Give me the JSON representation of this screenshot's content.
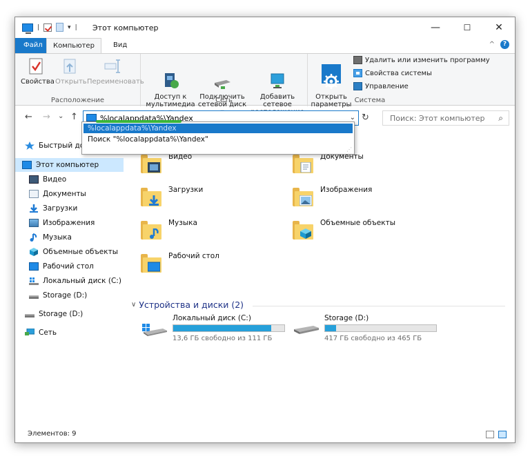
{
  "window": {
    "title": "Этот компьютер",
    "qat_separator": "|",
    "qat_dropdown": "▾",
    "controls": {
      "minimize": "—",
      "maximize": "☐",
      "close": "✕"
    },
    "help_chevron": "^",
    "help_label": "?"
  },
  "ribbon": {
    "tabs": [
      "Файл",
      "Компьютер",
      "Вид"
    ],
    "groups": {
      "location": {
        "label": "Расположение",
        "buttons": [
          {
            "label": "Свойства",
            "icon": "properties-icon",
            "enabled": true
          },
          {
            "label": "Открыть",
            "icon": "open-icon",
            "enabled": false
          },
          {
            "label": "Переименовать",
            "icon": "rename-icon",
            "enabled": false
          }
        ]
      },
      "network": {
        "label": "Сеть",
        "buttons": [
          {
            "label": "Доступ к\nмультимедиа ▾",
            "icon": "media-access-icon"
          },
          {
            "label": "Подключить\nсетевой диск ▾",
            "icon": "map-network-drive-icon"
          },
          {
            "label": "Добавить сетевое\nрасположение",
            "icon": "add-network-location-icon"
          }
        ]
      },
      "system": {
        "label": "Система",
        "open_settings": "Открыть\nпараметры",
        "items": [
          "Удалить или изменить программу",
          "Свойства системы",
          "Управление"
        ]
      }
    }
  },
  "address": {
    "nav": {
      "back": "←",
      "forward": "→",
      "recent": "⌄",
      "up": "↑"
    },
    "value": "%localappdata%\\Yandex",
    "dropdown_caret": "⌄",
    "refresh": "↻",
    "search_placeholder": "Поиск: Этот компьютер",
    "search_icon": "⌕",
    "suggestions": {
      "highlighted": "%localappdata%\\Yandex",
      "search": "Поиск \"%localappdata%\\Yandex\""
    }
  },
  "sidebar": {
    "items": [
      {
        "label": "Быстрый доступ",
        "icon": "star-icon"
      },
      {
        "label": "Этот компьютер",
        "icon": "computer-icon",
        "selected": true
      },
      {
        "label": "Видео",
        "icon": "video-icon"
      },
      {
        "label": "Документы",
        "icon": "documents-icon"
      },
      {
        "label": "Загрузки",
        "icon": "downloads-icon"
      },
      {
        "label": "Изображения",
        "icon": "pictures-icon"
      },
      {
        "label": "Музыка",
        "icon": "music-icon"
      },
      {
        "label": "Объемные объекты",
        "icon": "3d-objects-icon"
      },
      {
        "label": "Рабочий стол",
        "icon": "desktop-icon"
      },
      {
        "label": "Локальный диск (C:)",
        "icon": "local-disk-icon"
      },
      {
        "label": "Storage (D:)",
        "icon": "drive-icon"
      },
      {
        "label": "Storage (D:)",
        "icon": "drive-icon"
      },
      {
        "label": "Сеть",
        "icon": "network-icon"
      }
    ]
  },
  "content": {
    "folders": [
      {
        "name": "Видео",
        "badge": "video-icon"
      },
      {
        "name": "Документы",
        "badge": "documents-icon"
      },
      {
        "name": "Загрузки",
        "badge": "downloads-icon"
      },
      {
        "name": "Изображения",
        "badge": "pictures-icon"
      },
      {
        "name": "Музыка",
        "badge": "music-icon"
      },
      {
        "name": "Объемные объекты",
        "badge": "3d-objects-icon"
      },
      {
        "name": "Рабочий стол",
        "badge": "desktop-icon"
      }
    ],
    "devices_header": "Устройства и диски (2)",
    "devices_chevron": "∨",
    "drives": [
      {
        "name": "Локальный диск (C:)",
        "free": "13,6 ГБ свободно из 111 ГБ",
        "used_fraction": 0.88
      },
      {
        "name": "Storage (D:)",
        "free": "417 ГБ свободно из 465 ГБ",
        "used_fraction": 0.1
      }
    ]
  },
  "status": {
    "items": "Элементов: 9"
  },
  "colors": {
    "accent": "#1979ca",
    "selection": "#cce8ff",
    "bar_fill": "#26a0da",
    "folder": "#f7d36a"
  }
}
